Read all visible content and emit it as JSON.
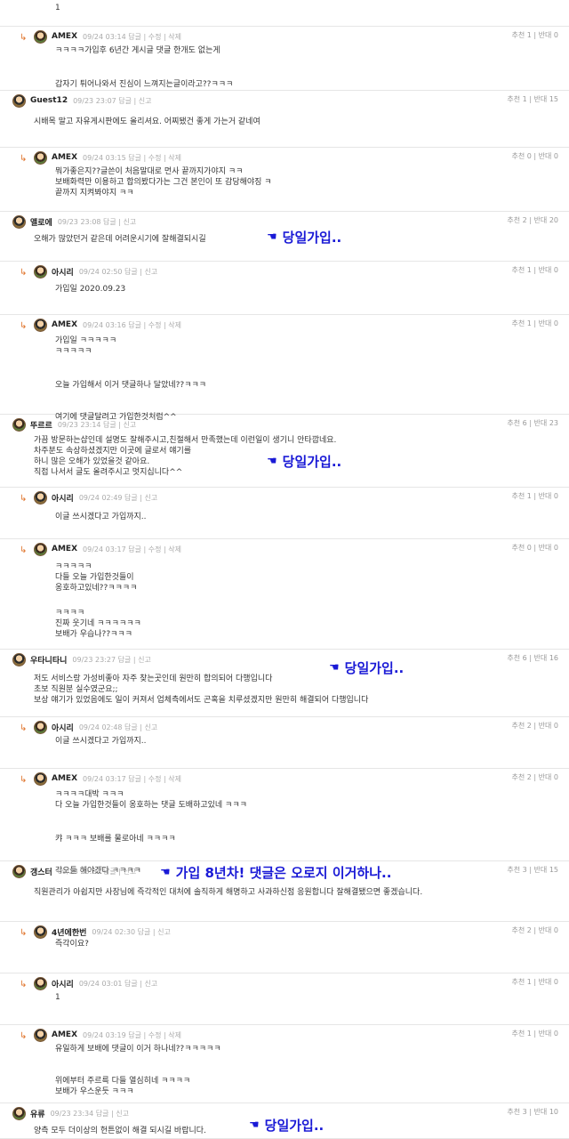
{
  "top_fragment": {
    "text": "1",
    "votes": ""
  },
  "comments": [
    {
      "nick": "AMEX",
      "meta": "09/24 03:14 답글 | 수정 | 삭제",
      "votes": "추천 1 | 반대 0",
      "reply": true,
      "lines": [
        "ㅋㅋㅋㅋ가입후 6년간 게시글 댓글 한개도 없는게",
        "",
        "갑자기 튀어나와서 진심이 느껴지는글이라고??ㅋㅋㅋ"
      ]
    },
    {
      "nick": "Guest12",
      "meta": "09/23 23:07 답글 | 신고",
      "votes": "추천 1 | 반대 15",
      "reply": false,
      "lines": [
        "시배목 말고 자유게시판에도 올리셔요. 어찌됐건 좋게 가는거 같네여"
      ]
    },
    {
      "nick": "AMEX",
      "meta": "09/24 03:15 답글 | 수정 | 삭제",
      "votes": "추천 0 | 반대 0",
      "reply": true,
      "lines": [
        "뭐가좋은지??글쓴이 처음말대로 먼사 끝까지가야지 ㅋㅋ",
        "보배화력만 이용하고 합의봤다가는 그건 본인이 또 감당해야징 ㅋ",
        "끝까지 지켜봐야지 ㅋㅋ"
      ]
    },
    {
      "nick": "앨로에",
      "meta": "09/23 23:08 답글 | 신고",
      "votes": "추천 2 | 반대 20",
      "reply": false,
      "lines": [
        "오해가 많았던거 같은데 어려운시기에 잘해결되시길"
      ],
      "note": "당일가입.."
    },
    {
      "nick": "아시리",
      "meta": "09/24 02:50 답글 | 신고",
      "votes": "추천 1 | 반대 0",
      "reply": true,
      "lines": [
        "가입일 2020.09.23"
      ]
    },
    {
      "nick": "AMEX",
      "meta": "09/24 03:16 답글 | 수정 | 삭제",
      "votes": "추천 1 | 반대 0",
      "reply": true,
      "lines": [
        "가입일 ㅋㅋㅋㅋㅋ",
        "ㅋㅋㅋㅋㅋ",
        "",
        "오늘 가입해서 이거 댓글하나 달았네??ㅋㅋㅋ",
        "",
        "여기에 댓글달려고 가입한것처럼^^"
      ]
    },
    {
      "nick": "뚜르르",
      "meta": "09/23 23:14 답글 | 신고",
      "votes": "추천 6 | 반대 23",
      "reply": false,
      "lines": [
        "가끔 방문하는샵인데 설명도 잘해주시고,친절해서 만족했는데 이런일이 생기니 안타깝네요.",
        "차주분도 속상하셨겠지만 이곳에 글로서 얘기를",
        "하니 많은 오해가 있었을것 같아요.",
        "직접 나서서 글도 올려주시고 멋지십니다^^"
      ],
      "note": "당일가입.."
    },
    {
      "nick": "아시리",
      "meta": "09/24 02:49 답글 | 신고",
      "votes": "추천 1 | 반대 0",
      "reply": true,
      "lines": [
        "이글 쓰시겠다고 가입까지.."
      ]
    },
    {
      "nick": "AMEX",
      "meta": "09/24 03:17 답글 | 수정 | 삭제",
      "votes": "추천 0 | 반대 0",
      "reply": true,
      "lines": [
        "ㅋㅋㅋㅋㅋ",
        "다들 오늘 가입한것들이",
        "옹호하고있네??ㅋㅋㅋㅋ",
        "",
        "ㅋㅋㅋㅋ",
        "진짜 웃기네 ㅋㅋㅋㅋㅋㅋ",
        "보배가 우습나??ㅋㅋㅋ"
      ]
    },
    {
      "nick": "우타니타니",
      "meta": "09/23 23:27 답글 | 신고",
      "votes": "추천 6 | 반대 16",
      "reply": false,
      "lines": [
        "저도 서비스랑 가성비좋아 자주 찾는곳인데 원만히 합의되어 다행입니다",
        "초보 직원분 실수였군요;;",
        "보상 얘기가 있었음에도 일이 커져서 업체측에서도 곤혹을 치루셨겠지만 원만히 해결되어 다행입니다"
      ],
      "note": "당일가입.."
    },
    {
      "nick": "아시리",
      "meta": "09/24 02:48 답글 | 신고",
      "votes": "추천 2 | 반대 0",
      "reply": true,
      "lines": [
        "이글 쓰시겠다고 가입까지.."
      ]
    },
    {
      "nick": "AMEX",
      "meta": "09/24 03:17 답글 | 수정 | 삭제",
      "votes": "추천 2 | 반대 0",
      "reply": true,
      "lines": [
        "ㅋㅋㅋㅋ대박 ㅋㅋㅋ",
        "다 오늘 가입한것들이 옹호하는 댓글 도배하고있네 ㅋㅋㅋ",
        "",
        "캬 ㅋㅋㅋ 보배를 물로아네 ㅋㅋㅋㅋ",
        "",
        "각오들 해야겠다 ㅋㅋㅋㅋ"
      ]
    },
    {
      "nick": "갱스터",
      "meta": "09/23 23:33 답글 | 신고",
      "votes": "추천 3 | 반대 15",
      "reply": false,
      "lines": [
        "직원관리가 아쉽지만 사장님에 즉각적인 대처에 솔직하게 해명하고 사과하신점 응원합니다 잘해결됐으면 좋겠습니다."
      ],
      "note": "가입 8년차! 댓글은 오로지 이거하나.."
    },
    {
      "nick": "4년에한번",
      "meta": "09/24 02:30 답글 | 신고",
      "votes": "추천 2 | 반대 0",
      "reply": true,
      "lines": [
        "즉각이요?"
      ]
    },
    {
      "nick": "아시리",
      "meta": "09/24 03:01 답글 | 신고",
      "votes": "추천 1 | 반대 0",
      "reply": true,
      "lines": [
        "1"
      ]
    },
    {
      "nick": "AMEX",
      "meta": "09/24 03:19 답글 | 수정 | 삭제",
      "votes": "추천 1 | 반대 0",
      "reply": true,
      "lines": [
        "유일하게 보배에 댓글이 이거 하나네??ㅋㅋㅋㅋㅋ",
        "",
        "위에부터 주르륵 다들 열심히네 ㅋㅋㅋㅋ",
        "",
        "보배가 우스운듯 ㅋㅋㅋ"
      ]
    },
    {
      "nick": "유류",
      "meta": "09/23 23:34 답글 | 신고",
      "votes": "추천 3 | 반대 10",
      "reply": false,
      "lines": [
        "양측 모두 더이상의 헌튼없이 해결 되시길 바랍니다."
      ],
      "note": "당일가입.."
    }
  ],
  "icons": {
    "reply_arrow": "reply-arrow-icon",
    "avatar": "avatar-icon",
    "pointing_hand": "pointing-hand-icon"
  },
  "colors": {
    "note": "#1a1ad6",
    "reply_arrow": "#e0742b"
  }
}
